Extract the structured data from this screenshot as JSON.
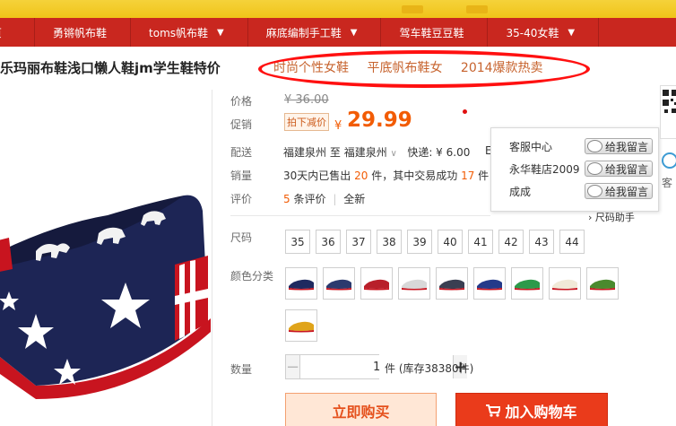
{
  "nav": {
    "items": [
      {
        "label": "页",
        "has_caret": false
      },
      {
        "label": "勇锵帆布鞋",
        "has_caret": false
      },
      {
        "label": "toms帆布鞋",
        "has_caret": true
      },
      {
        "label": "麻底编制手工鞋",
        "has_caret": true
      },
      {
        "label": "驾车鞋豆豆鞋",
        "has_caret": false
      },
      {
        "label": "35-40女鞋",
        "has_caret": true
      }
    ]
  },
  "product": {
    "title": "乐玛丽布鞋浅口懒人鞋jm学生鞋特价",
    "promo_phrases": [
      "时尚个性女鞋",
      "平底帆布鞋女",
      "2014爆款热卖"
    ]
  },
  "price_block": {
    "price_label": "价格",
    "original_price": "¥ 36.00",
    "promo_label": "促销",
    "promo_tag": "拍下减价",
    "currency": "¥",
    "current_price": "29.99"
  },
  "shipping": {
    "label": "配送",
    "from": "福建泉州",
    "to_word": "至",
    "to": "福建泉州",
    "dropdown_caret": "∨",
    "express": "快递: ¥ 6.00",
    "cut_text": "E"
  },
  "sales": {
    "label": "销量",
    "prefix": "30天内已售出",
    "sold_count": "20",
    "middle": "件，其中交易成功",
    "success_count": "17",
    "suffix": "件"
  },
  "reviews": {
    "label": "评价",
    "count": "5",
    "count_suffix": "条评价",
    "separator": "|",
    "new_label": "全新"
  },
  "service_panel": {
    "rows": [
      {
        "name": "客服中心",
        "button": "给我留言"
      },
      {
        "name": "永华鞋店2009",
        "button": "给我留言"
      },
      {
        "name": "成成",
        "button": "给我留言"
      }
    ],
    "size_helper": "尺码助手"
  },
  "sizes": {
    "label": "尺码",
    "options": [
      "35",
      "36",
      "37",
      "38",
      "39",
      "40",
      "41",
      "42",
      "43",
      "44"
    ]
  },
  "colors": {
    "label": "颜色分类",
    "swatches": [
      "#1f2a60",
      "#2b3a6e",
      "#b81f2a",
      "#d8d8d8",
      "#3a3f52",
      "#243a8a",
      "#2c9a4a",
      "#f1ead8",
      "#4a8a2e",
      "#e0a41a"
    ]
  },
  "quantity": {
    "label": "数量",
    "value": "1",
    "minus": "−",
    "plus": "+",
    "stock_text": "件 (库存38380件)"
  },
  "actions": {
    "buy_now": "立即购买",
    "add_to_cart": "加入购物车"
  },
  "sidebar": {
    "text": "客"
  },
  "theme": {
    "nav_red": "#c9271f",
    "price_orange": "#f25c05",
    "cart_red": "#ea3b1b",
    "annotation_red": "#ff1010"
  }
}
